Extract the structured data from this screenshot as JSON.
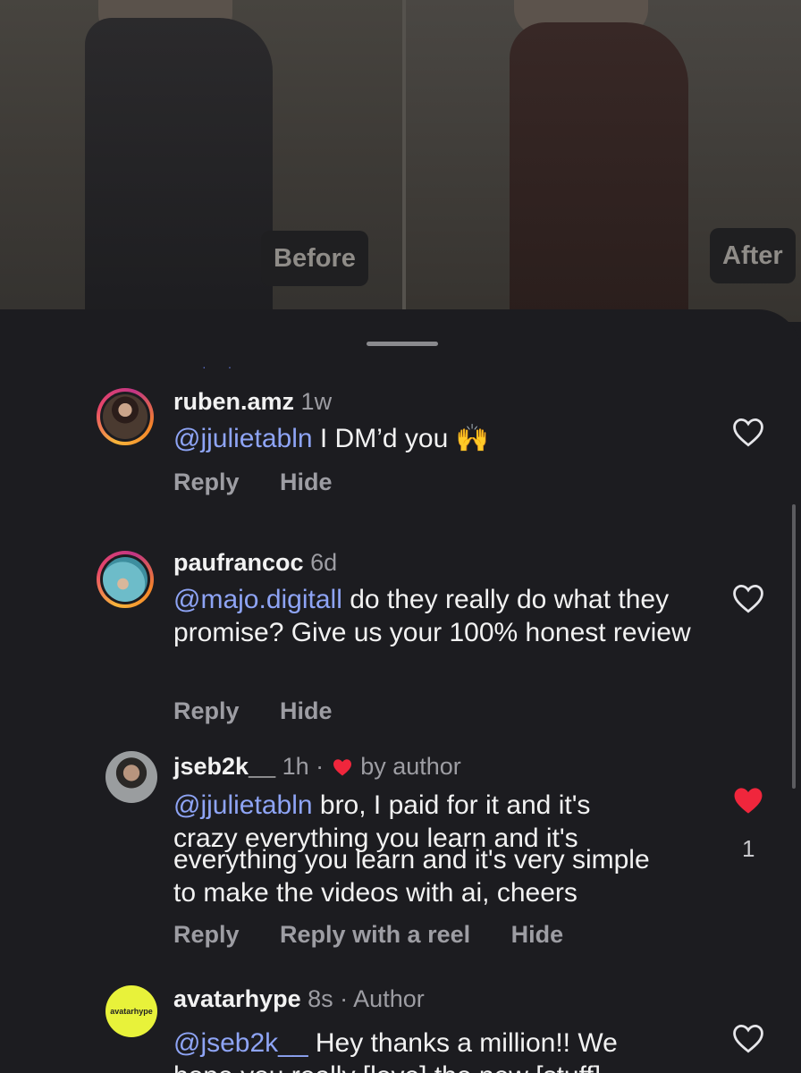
{
  "media": {
    "before_label": "Before",
    "after_label": "After"
  },
  "comments": [
    {
      "username": "ruben.amz",
      "time": "1w",
      "mention": "@jjulietabln",
      "text": " I DM’d you 🙌",
      "actions": [
        "Reply",
        "Hide"
      ],
      "liked": false
    },
    {
      "username": "paufrancoc",
      "time": "6d",
      "mention": "@majo.digitall",
      "text": " do they really do what they promise? Give us your 100% honest review",
      "actions": [
        "Reply",
        "Hide"
      ],
      "liked": false
    },
    {
      "username": "jseb2k__",
      "time": "1h",
      "separator": "·",
      "badge": "by author",
      "mention": "@jjulietabln",
      "text_line1": " bro, I paid for it and it's",
      "text_line2": "crazy everything you learn and it's",
      "text_line3": "everything you learn and it's very simple",
      "text_line4": "to make the videos with ai, cheers",
      "actions": [
        "Reply",
        "Reply with a reel",
        "Hide"
      ],
      "liked": true,
      "like_count": "1"
    },
    {
      "username": "avatarhype",
      "time": "8s",
      "separator": "·",
      "badge": "Author",
      "avatar_text": "avatarhype",
      "mention": "@jseb2k__",
      "text": "  Hey thanks a million!! We",
      "text_line2": "hope you really [love] the new [stuff]",
      "liked": false
    }
  ],
  "colors": {
    "background": "#1c1c20",
    "mention": "#8ea4f5",
    "like_red": "#f0263c",
    "secondary_text": "#9d9da3"
  },
  "icons": [
    "heart-outline-icon",
    "heart-filled-icon",
    "raising-hands-emoji"
  ]
}
